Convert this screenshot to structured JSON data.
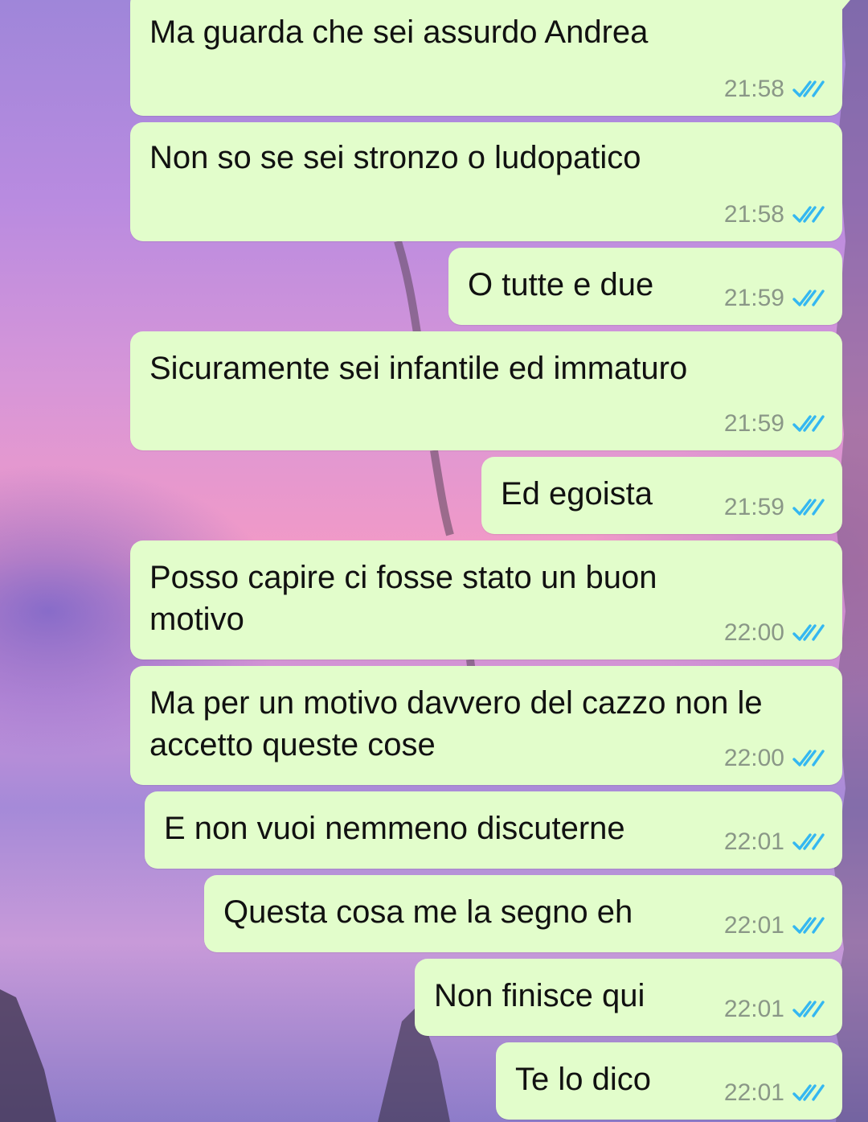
{
  "colors": {
    "bubble_background": "#e2fdcb",
    "message_text": "#111111",
    "timestamp_text": "#8a9787",
    "read_ticks": "#34b7f1"
  },
  "icons": {
    "read_receipt": "double-check-icon"
  },
  "messages": [
    {
      "text": "Ma guarda che sei assurdo Andrea",
      "time": "21:58",
      "status": "read"
    },
    {
      "text": "Non so se sei stronzo o ludopatico",
      "time": "21:58",
      "status": "read"
    },
    {
      "text": "O tutte e due",
      "time": "21:59",
      "status": "read"
    },
    {
      "text": "Sicuramente sei infantile ed immaturo",
      "time": "21:59",
      "status": "read"
    },
    {
      "text": "Ed egoista",
      "time": "21:59",
      "status": "read"
    },
    {
      "text": "Posso capire ci fosse stato un buon motivo",
      "time": "22:00",
      "status": "read"
    },
    {
      "text": "Ma per un motivo davvero del cazzo non le accetto queste cose",
      "time": "22:00",
      "status": "read"
    },
    {
      "text": "E non vuoi nemmeno discuterne",
      "time": "22:01",
      "status": "read"
    },
    {
      "text": "Questa cosa me la segno eh",
      "time": "22:01",
      "status": "read"
    },
    {
      "text": "Non finisce qui",
      "time": "22:01",
      "status": "read"
    },
    {
      "text": "Te lo dico",
      "time": "22:01",
      "status": "read"
    }
  ]
}
